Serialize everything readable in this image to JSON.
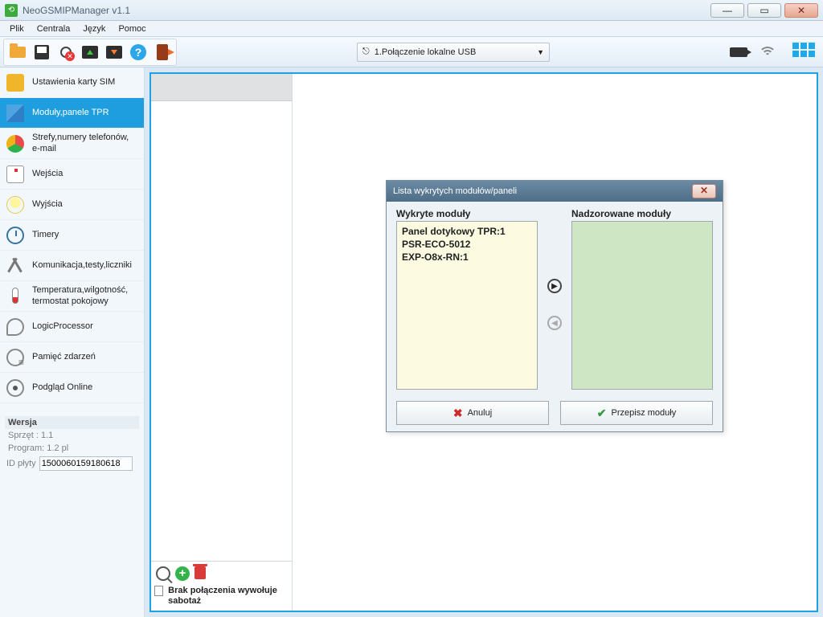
{
  "window": {
    "title": "NeoGSMIPManager v1.1"
  },
  "menu": {
    "plik": "Plik",
    "centrala": "Centrala",
    "jezyk": "Język",
    "pomoc": "Pomoc"
  },
  "toolbar": {
    "connection": "1.Połączenie lokalne USB"
  },
  "sidebar": {
    "items": [
      {
        "label": "Ustawienia karty SIM"
      },
      {
        "label": "Moduły,panele TPR"
      },
      {
        "label": "Strefy,numery telefonów, e-mail"
      },
      {
        "label": "Wejścia"
      },
      {
        "label": "Wyjścia"
      },
      {
        "label": "Timery"
      },
      {
        "label": "Komunikacja,testy,liczniki"
      },
      {
        "label": "Temperatura,wilgotność, termostat pokojowy"
      },
      {
        "label": "LogicProcessor"
      },
      {
        "label": "Pamięć zdarzeń"
      },
      {
        "label": "Podgląd Online"
      }
    ]
  },
  "version": {
    "header": "Wersja",
    "sprzet": "Sprzęt : 1.1",
    "program": "Program: 1.2 pl",
    "id_label": "ID płyty",
    "id_value": "1500060159180618"
  },
  "panel": {
    "sabotaz": "Brak połączenia wywołuje sabotaż"
  },
  "dialog": {
    "title": "Lista wykrytych modułów/paneli",
    "left_header": "Wykryte moduły",
    "right_header": "Nadzorowane moduły",
    "detected": [
      "Panel dotykowy TPR:1",
      "PSR-ECO-5012",
      "EXP-O8x-RN:1"
    ],
    "cancel": "Anuluj",
    "assign": "Przepisz moduły"
  }
}
